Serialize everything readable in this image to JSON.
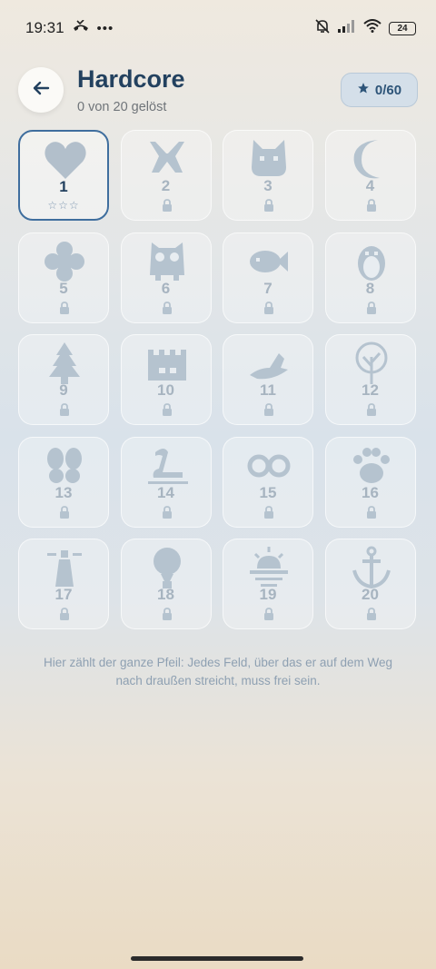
{
  "status_bar": {
    "time": "19:31",
    "battery": "24",
    "icons": [
      "missed-call-icon",
      "more-dots-icon",
      "mute-bell-icon",
      "signal-icon",
      "wifi-icon",
      "battery-icon"
    ]
  },
  "header": {
    "title": "Hardcore",
    "subtitle": "0 von 20 gelöst",
    "stars_label": "0/60",
    "back_icon": "back-arrow-icon"
  },
  "levels": [
    {
      "number": "1",
      "icon": "heart-icon",
      "locked": false,
      "stars": "☆☆☆"
    },
    {
      "number": "2",
      "icon": "bow-tie-icon",
      "locked": true
    },
    {
      "number": "3",
      "icon": "cat-face-icon",
      "locked": true
    },
    {
      "number": "4",
      "icon": "crescent-moon-icon",
      "locked": true
    },
    {
      "number": "5",
      "icon": "flower-icon",
      "locked": true
    },
    {
      "number": "6",
      "icon": "owl-icon",
      "locked": true
    },
    {
      "number": "7",
      "icon": "fish-icon",
      "locked": true
    },
    {
      "number": "8",
      "icon": "penguin-icon",
      "locked": true
    },
    {
      "number": "9",
      "icon": "pine-tree-icon",
      "locked": true
    },
    {
      "number": "10",
      "icon": "castle-icon",
      "locked": true
    },
    {
      "number": "11",
      "icon": "bird-icon",
      "locked": true
    },
    {
      "number": "12",
      "icon": "round-tree-icon",
      "locked": true
    },
    {
      "number": "13",
      "icon": "butterfly-icon",
      "locked": true
    },
    {
      "number": "14",
      "icon": "swan-icon",
      "locked": true
    },
    {
      "number": "15",
      "icon": "infinity-icon",
      "locked": true
    },
    {
      "number": "16",
      "icon": "paw-print-icon",
      "locked": true
    },
    {
      "number": "17",
      "icon": "lighthouse-icon",
      "locked": true
    },
    {
      "number": "18",
      "icon": "hot-air-balloon-icon",
      "locked": true
    },
    {
      "number": "19",
      "icon": "sunset-icon",
      "locked": true
    },
    {
      "number": "20",
      "icon": "anchor-icon",
      "locked": true
    }
  ],
  "hint": "Hier zählt der ganze Pfeil: Jedes Feld, über das er auf dem Weg nach draußen streicht, muss frei sein.",
  "colors": {
    "title": "#23415f",
    "accent": "#3f6e9e",
    "locked_number": "#a7b4c0",
    "icon_fill": "#b5c3cf"
  }
}
